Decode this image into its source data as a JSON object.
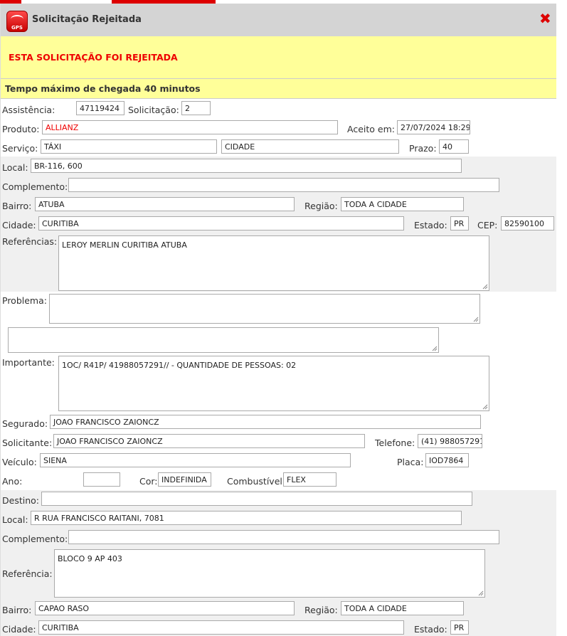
{
  "window": {
    "title": "Solicitação Rejeitada",
    "logo_text": "GPS"
  },
  "alert": {
    "message": "ESTA SOLICITAÇÃO FOI REJEITADA"
  },
  "time_notice": "Tempo máximo de chegada 40 minutos",
  "labels": {
    "assistencia": "Assistência:",
    "solicitacao": "Solicitação:",
    "produto": "Produto:",
    "aceito": "Aceito em:",
    "servico": "Serviço:",
    "prazo": "Prazo:",
    "local": "Local:",
    "complemento": "Complemento:",
    "bairro": "Bairro:",
    "regiao": "Região:",
    "cidade": "Cidade:",
    "estado": "Estado:",
    "cep": "CEP:",
    "referencias": "Referências:",
    "problema": "Problema:",
    "importante": "Importante:",
    "segurado": "Segurado:",
    "solicitante": "Solicitante:",
    "telefone": "Telefone:",
    "veiculo": "Veículo:",
    "placa": "Placa:",
    "ano": "Ano:",
    "cor": "Cor:",
    "combustivel": "Combustível:",
    "destino": "Destino:",
    "referencia": "Referência:"
  },
  "values": {
    "assistencia": "47119424",
    "solicitacao": "2",
    "produto": "ALLIANZ",
    "aceito": "27/07/2024 18:29",
    "servico": "TÁXI",
    "servico2": "CIDADE",
    "prazo": "40",
    "local": "BR-116, 600",
    "complemento": "",
    "bairro": "ATUBA",
    "regiao": "TODA A CIDADE",
    "cidade": "CURITIBA",
    "estado": "PR",
    "cep": "82590100",
    "referencias": "LEROY MERLIN CURITIBA ATUBA",
    "problema": "",
    "problema2": "",
    "importante": "1OC/ R41P/ 41988057291// - QUANTIDADE DE PESSOAS: 02",
    "segurado": "JOAO FRANCISCO ZAIONCZ",
    "solicitante": "JOAO FRANCISCO ZAIONCZ",
    "telefone": "(41) 988057291",
    "veiculo": "SIENA",
    "placa": "IOD7864",
    "ano": "",
    "cor": "INDEFINIDA",
    "combustivel": "FLEX",
    "destino": "",
    "dest_local": "R RUA FRANCISCO RAITANI, 7081",
    "dest_complemento": "",
    "dest_referencia": "BLOCO 9 AP 403",
    "dest_bairro": "CAPAO RASO",
    "dest_regiao": "TODA A CIDADE",
    "dest_cidade": "CURITIBA",
    "dest_estado": "PR"
  },
  "colors": {
    "accent": "#dd0000",
    "alert_bg": "#ffff99",
    "band_bg": "#f0f0f0"
  },
  "icons": {
    "logo": "gps-logo-icon",
    "close": "close-icon"
  }
}
